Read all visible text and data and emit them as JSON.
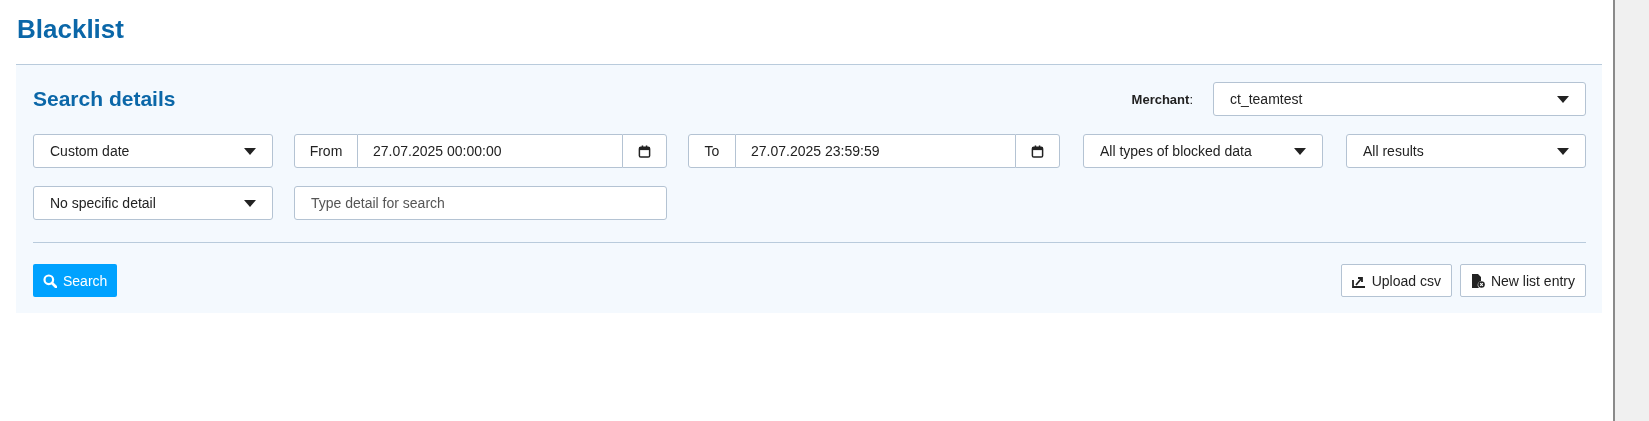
{
  "page_title": "Blacklist",
  "search_panel": {
    "title": "Search details",
    "merchant": {
      "label": "**Merchant**:",
      "value": "ct_teamtest"
    },
    "date_range_select": {
      "value": "Custom date"
    },
    "from": {
      "label": "From",
      "value": "27.07.2025 00:00:00"
    },
    "to": {
      "label": "To",
      "value": "27.07.2025 23:59:59"
    },
    "data_type_select": {
      "value": "All types of blocked data"
    },
    "results_select": {
      "value": "All results"
    },
    "detail_select": {
      "value": "No specific detail"
    },
    "detail_input": {
      "placeholder": "Type detail for search"
    },
    "buttons": [
      {
        "kind": "search",
        "label": "Search"
      },
      {
        "kind": "upload",
        "label": "Upload csv"
      },
      {
        "kind": "new",
        "label": "New list entry"
      }
    ]
  }
}
